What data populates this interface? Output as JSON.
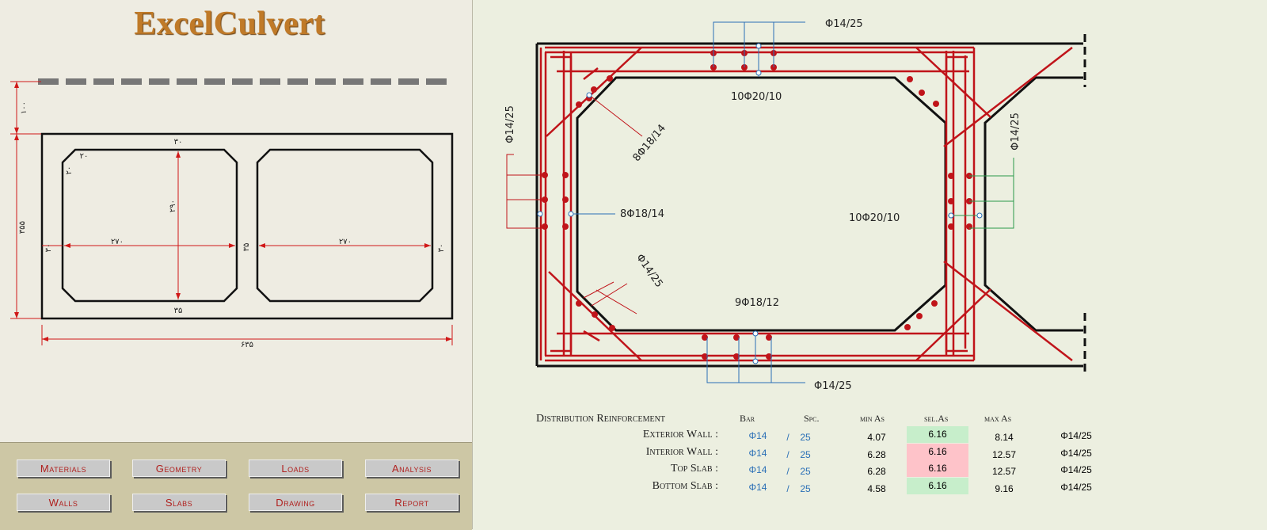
{
  "app": {
    "title": "ExcelCulvert"
  },
  "geometry_dims": {
    "top_fill": "۱۰۰",
    "wall_top": "۳۰",
    "haunch_h": "۲۰",
    "haunch_v": "۲۰",
    "inner_height": "۲۹۰",
    "total_height": "۳۵۵",
    "ext_wall_left": "۳۰",
    "cell_width_1": "۲۷۰",
    "int_wall": "۳۵",
    "cell_width_2": "۲۷۰",
    "ext_wall_right": "۳۰",
    "bottom_slab": "۳۵",
    "total_width": "۶۳۵"
  },
  "buttons": [
    "Materials",
    "Geometry",
    "Loads",
    "Analysis",
    "Walls",
    "Slabs",
    "Drawing",
    "Report"
  ],
  "drawing_labels": {
    "top_dist": "Φ14/25",
    "top_main": "10Φ20/10",
    "left_dist": "Φ14/25",
    "haunch_top": "8Φ18/14",
    "left_wall_main": "8Φ18/14",
    "right_dist": "Φ14/25",
    "right_wall_main": "10Φ20/10",
    "haunch_bottom": "Φ14/25",
    "bottom_main": "9Φ18/12",
    "bottom_dist": "Φ14/25"
  },
  "distribution": {
    "title": "Distribution Reinforcement",
    "headers": {
      "bar": "Bar",
      "spc": "Spc.",
      "min": "min As",
      "sel": "sel.As",
      "max": "max As"
    },
    "sep": "/",
    "rows": [
      {
        "label": "Exterior Wall :",
        "bar": "Φ14",
        "spc": "25",
        "min": "4.07",
        "sel": "6.16",
        "max": "8.14",
        "result": "Φ14/25",
        "ok": true
      },
      {
        "label": "Interior Wall :",
        "bar": "Φ14",
        "spc": "25",
        "min": "6.28",
        "sel": "6.16",
        "max": "12.57",
        "result": "Φ14/25",
        "ok": false
      },
      {
        "label": "Top Slab :",
        "bar": "Φ14",
        "spc": "25",
        "min": "6.28",
        "sel": "6.16",
        "max": "12.57",
        "result": "Φ14/25",
        "ok": false
      },
      {
        "label": "Bottom Slab :",
        "bar": "Φ14",
        "spc": "25",
        "min": "4.58",
        "sel": "6.16",
        "max": "9.16",
        "result": "Φ14/25",
        "ok": true
      }
    ]
  },
  "colors": {
    "rebar": "#c0141a",
    "annot_blue": "#2a6fb6",
    "annot_green": "#2a9a4a",
    "concrete": "#111111",
    "sel_ok": "#c7eecb",
    "sel_bad": "#fec3c9",
    "title": "#c07a28"
  }
}
